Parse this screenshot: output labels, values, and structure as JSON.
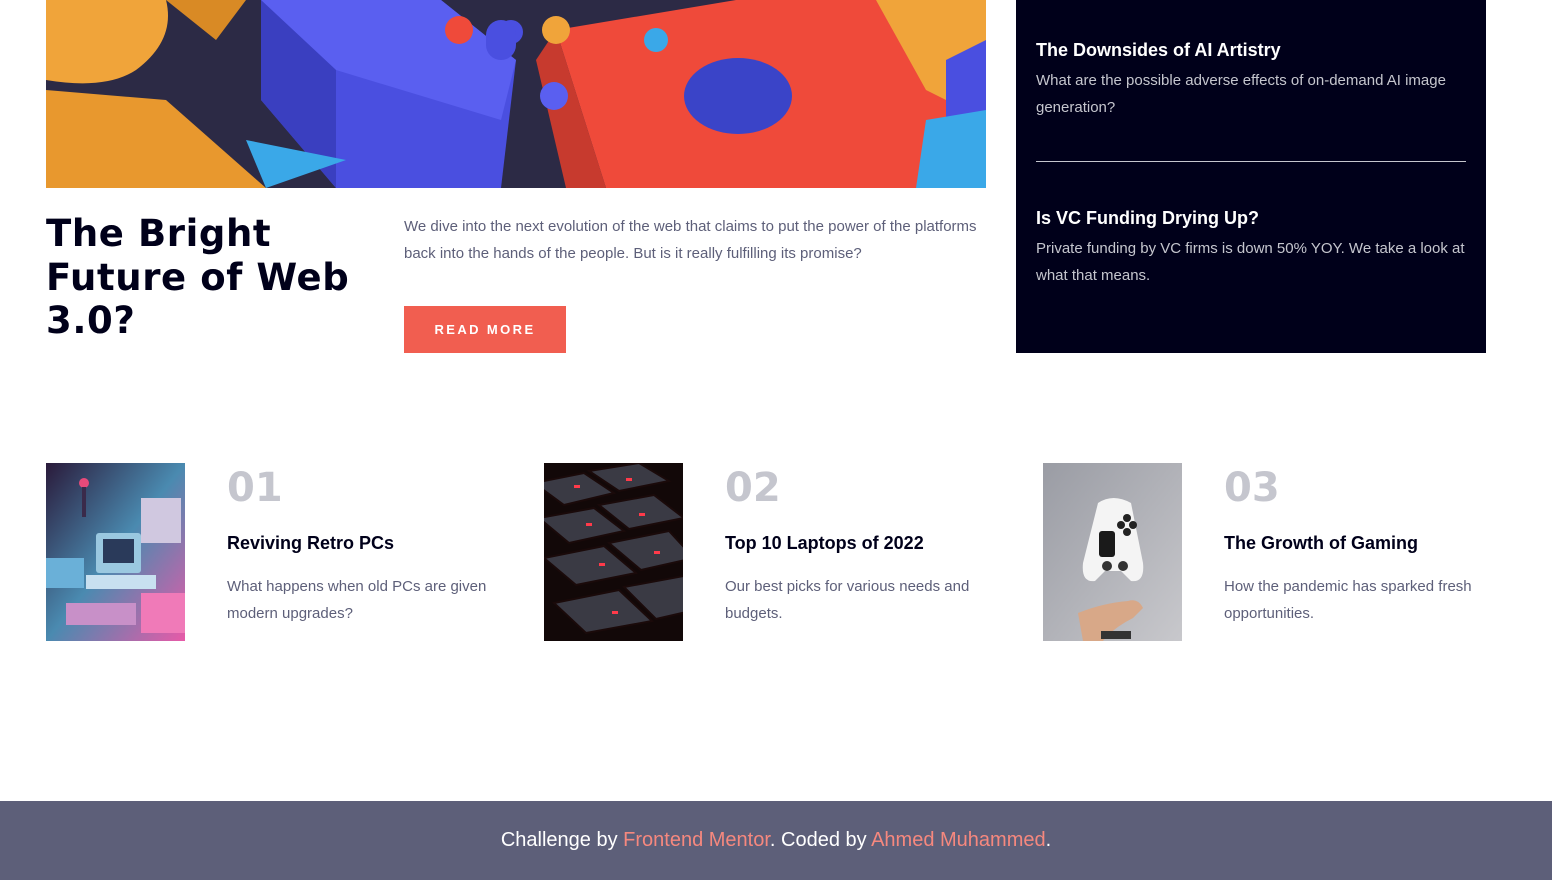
{
  "hero": {
    "title": "The Bright Future of Web 3.0?",
    "description": "We dive into the next evolution of the web that claims to put the power of the platforms back into the hands of the people. But is it really fulfilling its promise?",
    "button_label": "READ MORE",
    "image": "abstract-3d-blocks-image"
  },
  "new_panel": {
    "items": [
      {
        "title": "The Downsides of AI Artistry",
        "description": "What are the possible adverse effects of on-demand AI image generation?"
      },
      {
        "title": "Is VC Funding Drying Up?",
        "description": "Private funding by VC firms is down 50% YOY. We take a look at what that means."
      }
    ]
  },
  "articles": [
    {
      "number": "01",
      "title": "Reviving Retro PCs",
      "description": "What happens when old PCs are given modern upgrades?",
      "image": "retro-pc-image"
    },
    {
      "number": "02",
      "title": "Top 10 Laptops of 2022",
      "description": "Our best picks for various needs and budgets.",
      "image": "laptop-keyboard-image"
    },
    {
      "number": "03",
      "title": "The Growth of Gaming",
      "description": "How the pandemic has sparked fresh opportunities.",
      "image": "gamepad-image"
    }
  ],
  "footer": {
    "prefix": "Challenge by ",
    "link1": "Frontend Mentor",
    "middle": ". Coded by ",
    "link2": "Ahmed Muhammed",
    "suffix": "."
  },
  "colors": {
    "accent": "#f15e50",
    "dark": "#00001a",
    "muted": "#5d5f79",
    "light_gray": "#c5c6ce",
    "footer_bg": "#5d5f79",
    "footer_link": "#f6887e"
  }
}
